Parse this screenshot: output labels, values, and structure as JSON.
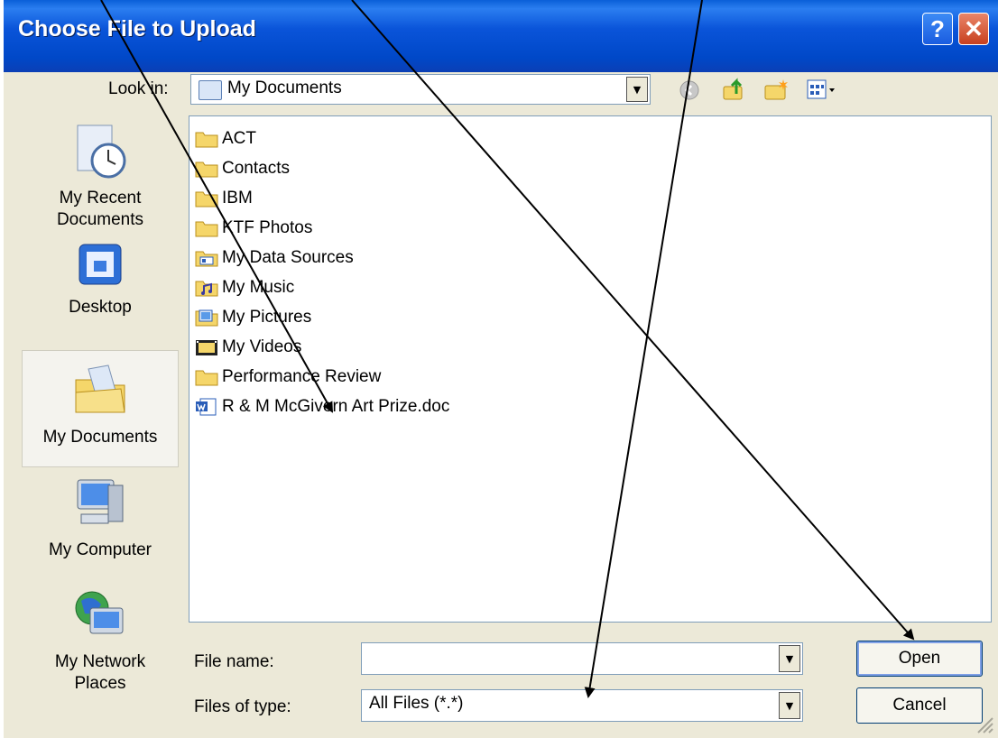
{
  "dialog": {
    "title": "Choose File to Upload",
    "help": "?",
    "close": "✕"
  },
  "lookin": {
    "label": "Look in:",
    "value": "My Documents"
  },
  "toolbar": [
    "back-icon",
    "up-folder-icon",
    "new-folder-icon",
    "view-menu-icon"
  ],
  "places": [
    {
      "label": "My Recent Documents",
      "line1": "My Recent",
      "line2": "Documents",
      "icon": "recent-documents-icon"
    },
    {
      "label": "Desktop",
      "line1": "Desktop",
      "line2": "",
      "icon": "desktop-icon"
    },
    {
      "label": "My Documents",
      "line1": "My Documents",
      "line2": "",
      "icon": "my-documents-icon"
    },
    {
      "label": "My Computer",
      "line1": "My Computer",
      "line2": "",
      "icon": "my-computer-icon"
    },
    {
      "label": "My Network Places",
      "line1": "My Network",
      "line2": "Places",
      "icon": "network-places-icon"
    }
  ],
  "files": [
    {
      "name": "ACT",
      "icon": "folder-icon"
    },
    {
      "name": "Contacts",
      "icon": "folder-icon"
    },
    {
      "name": "IBM",
      "icon": "folder-icon"
    },
    {
      "name": "KTF Photos",
      "icon": "folder-icon"
    },
    {
      "name": "My Data Sources",
      "icon": "data-sources-folder-icon"
    },
    {
      "name": "My Music",
      "icon": "music-folder-icon"
    },
    {
      "name": "My Pictures",
      "icon": "pictures-folder-icon"
    },
    {
      "name": "My Videos",
      "icon": "videos-folder-icon"
    },
    {
      "name": "Performance Review",
      "icon": "folder-icon"
    },
    {
      "name": "R & M McGivern Art Prize.doc",
      "icon": "word-document-icon"
    }
  ],
  "filename": {
    "label": "File name:",
    "value": ""
  },
  "filetype": {
    "label": "Files of type:",
    "value": "All Files (*.*)"
  },
  "buttons": {
    "open": "Open",
    "cancel": "Cancel"
  },
  "colors": {
    "titlebar": "#0a54d9",
    "dialog_bg": "#ece9d8",
    "close_button": "#c8401e",
    "folder": "#f5d66a"
  }
}
